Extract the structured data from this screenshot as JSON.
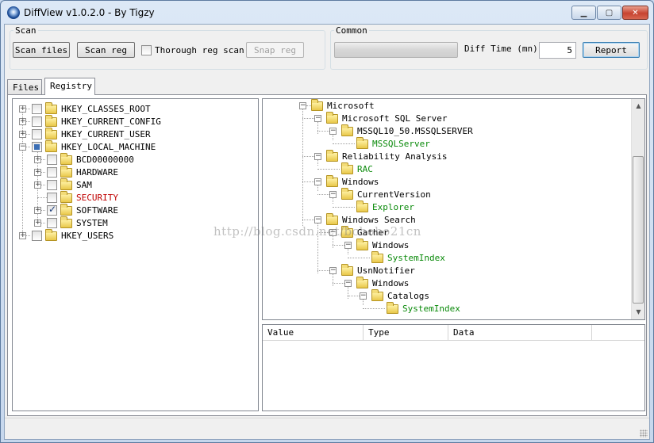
{
  "window": {
    "title": "DiffView v1.0.2.0 - By Tigzy",
    "min": "▁",
    "max": "▢",
    "close": "✕"
  },
  "scan": {
    "legend": "Scan",
    "scan_files": "Scan files",
    "scan_reg": "Scan reg",
    "thorough_label": "Thorough reg scan",
    "snap_reg": "Snap reg"
  },
  "common": {
    "legend": "Common",
    "diff_time_label": "Diff Time (mn)",
    "diff_time_value": "5",
    "report": "Report",
    "progress": 0
  },
  "tabs": {
    "files": "Files",
    "registry": "Registry"
  },
  "left_tree": {
    "hkcr": "HKEY_CLASSES_ROOT",
    "hkcc": "HKEY_CURRENT_CONFIG",
    "hkcu": "HKEY_CURRENT_USER",
    "hklm": "HKEY_LOCAL_MACHINE",
    "bcd": "BCD00000000",
    "hardware": "HARDWARE",
    "sam": "SAM",
    "security": "SECURITY",
    "software": "SOFTWARE",
    "system": "SYSTEM",
    "hku": "HKEY_USERS"
  },
  "right_tree": {
    "microsoft": "Microsoft",
    "sqlserver": "Microsoft SQL Server",
    "mssql": "MSSQL10_50.MSSQLSERVER",
    "mssqlserver": "MSSQLServer",
    "reliability": "Reliability Analysis",
    "rac": "RAC",
    "windows": "Windows",
    "currentversion": "CurrentVersion",
    "explorer": "Explorer",
    "windows_search": "Windows Search",
    "gather": "Gather",
    "gather_windows": "Windows",
    "systemindex1": "SystemIndex",
    "usnnotifier": "UsnNotifier",
    "usn_windows": "Windows",
    "catalogs": "Catalogs",
    "systemindex2": "SystemIndex"
  },
  "values_table": {
    "columns": [
      "Value",
      "Type",
      "Data"
    ]
  },
  "watermark": "http://blog.csdn.net/bcbobo21cn"
}
